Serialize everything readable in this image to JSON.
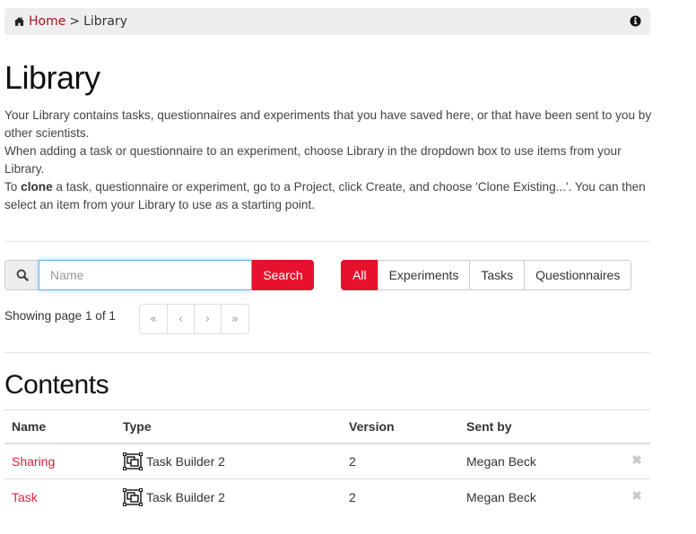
{
  "breadcrumb": {
    "home_label": "Home",
    "separator": ">",
    "current": "Library",
    "icons": {
      "home": "home-icon",
      "info": "info-circle-icon"
    }
  },
  "page": {
    "title": "Library",
    "intro": {
      "line1": "Your Library contains tasks, questionnaires and experiments that you have saved here, or that have been sent to you by other scientists.",
      "line2": "When adding a task or questionnaire to an experiment, choose Library in the dropdown box to use items from your Library.",
      "line3_prefix": "To ",
      "line3_bold": "clone",
      "line3_suffix": " a task, questionnaire or experiment, go to a Project, click Create, and choose 'Clone Existing...'. You can then select an item from your Library to use as a starting point."
    }
  },
  "search": {
    "icon": "search-icon",
    "placeholder": "Name",
    "value": "",
    "button_label": "Search"
  },
  "filters": {
    "items": [
      {
        "label": "All",
        "active": true
      },
      {
        "label": "Experiments",
        "active": false
      },
      {
        "label": "Tasks",
        "active": false
      },
      {
        "label": "Questionnaires",
        "active": false
      }
    ]
  },
  "pagination": {
    "status": "Showing page 1 of 1",
    "current_page": 1,
    "total_pages": 1,
    "buttons": {
      "first": "«",
      "prev": "‹",
      "next": "›",
      "last": "»"
    }
  },
  "contents": {
    "title": "Contents",
    "columns": [
      "Name",
      "Type",
      "Version",
      "Sent by",
      ""
    ],
    "rows": [
      {
        "name": "Sharing",
        "type": "Task Builder 2",
        "version": "2",
        "sent_by": "Megan Beck"
      },
      {
        "name": "Task",
        "type": "Task Builder 2",
        "version": "2",
        "sent_by": "Megan Beck"
      }
    ]
  },
  "colors": {
    "accent": "#e8112d",
    "link": "#a6121f",
    "row_link": "#d9243a",
    "breadcrumb_bg": "#eeeeee"
  }
}
